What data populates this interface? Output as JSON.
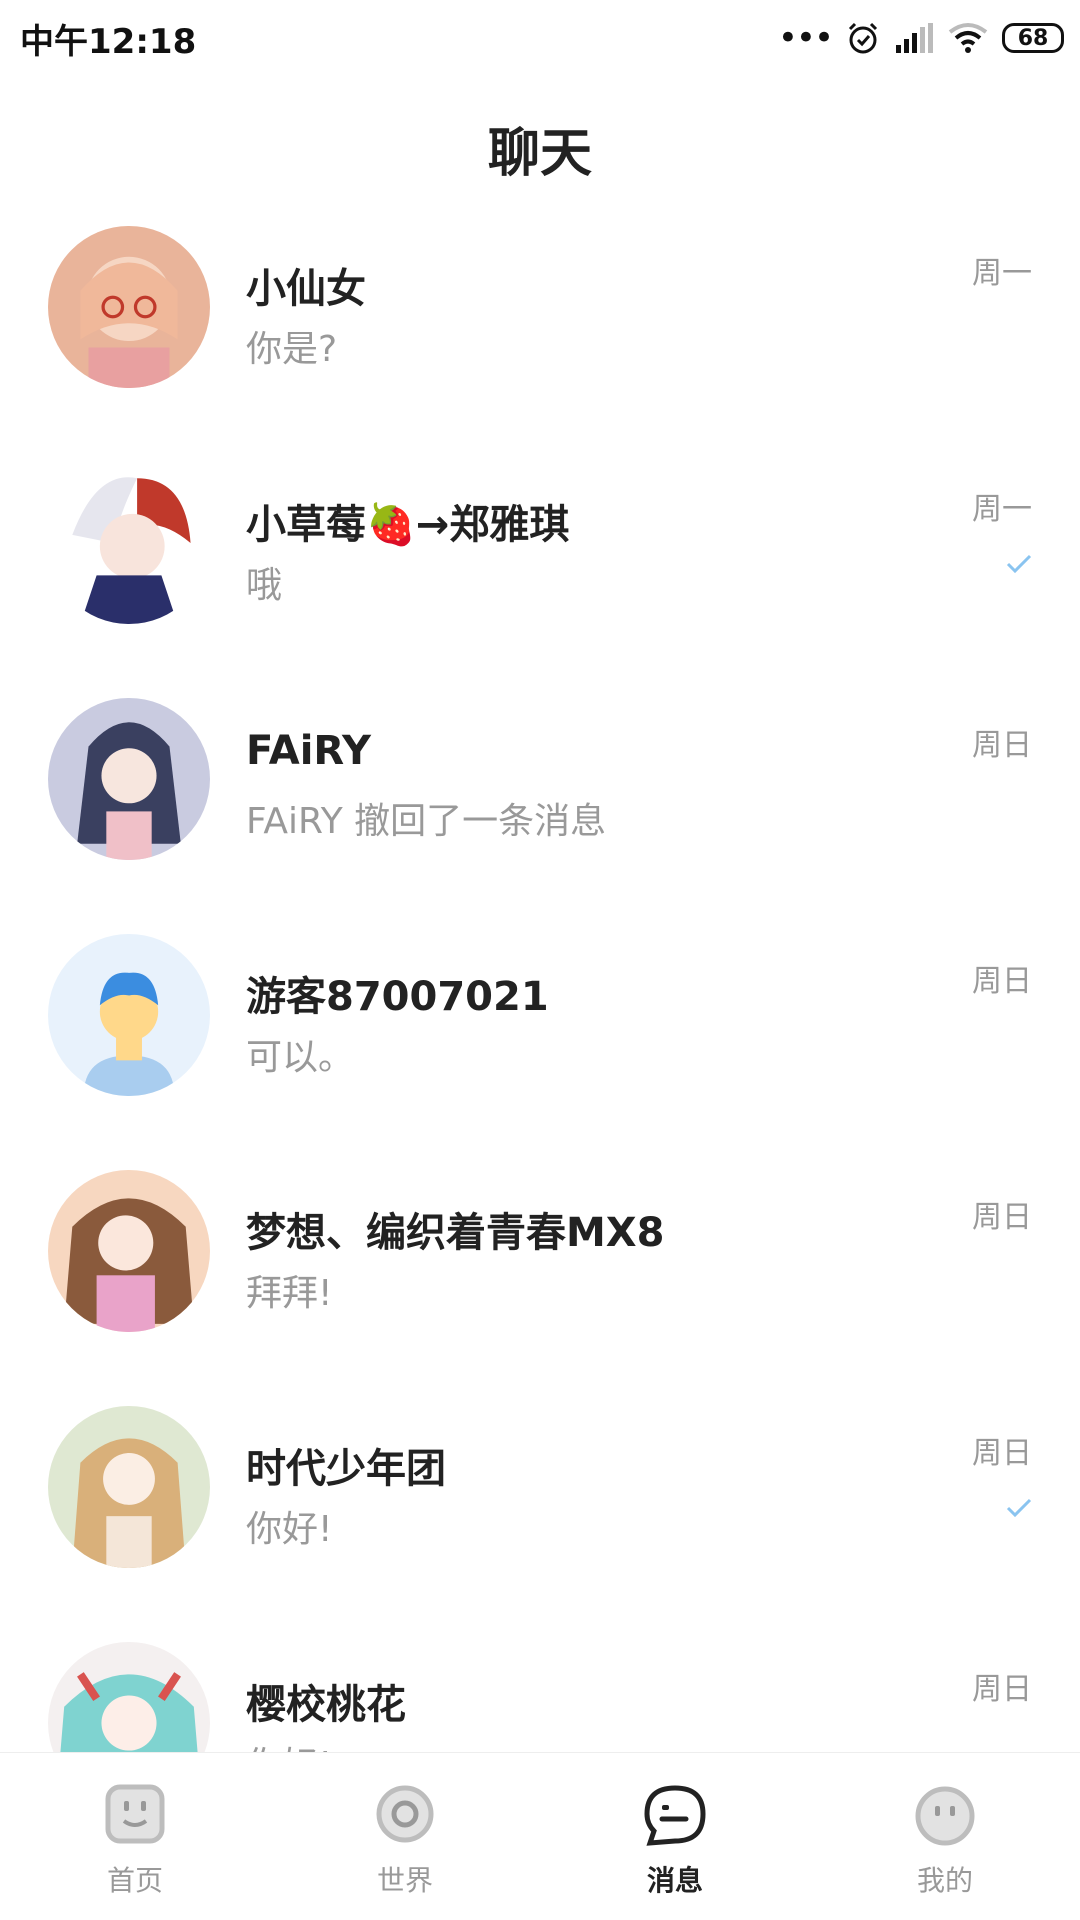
{
  "status_bar": {
    "time": "中午12:18",
    "dots": "•••",
    "battery": "68"
  },
  "header": {
    "title": "聊天"
  },
  "chats": [
    {
      "name": "小仙女",
      "preview": "你是?",
      "time": "周一",
      "read_check": false
    },
    {
      "name": "小草莓🍓→郑雅琪",
      "preview": "哦",
      "time": "周一",
      "read_check": true
    },
    {
      "name": "FAiRY",
      "preview": "FAiRY 撤回了一条消息",
      "time": "周日",
      "read_check": false
    },
    {
      "name": "游客87007021",
      "preview": "可以。",
      "time": "周日",
      "read_check": false
    },
    {
      "name": "梦想、编织着青春MX8",
      "preview": "拜拜!",
      "time": "周日",
      "read_check": false
    },
    {
      "name": "时代少年团",
      "preview": "你好!",
      "time": "周日",
      "read_check": true
    },
    {
      "name": "樱校桃花",
      "preview": "你好!",
      "time": "周日",
      "read_check": false
    }
  ],
  "bottom_nav": [
    {
      "label": "首页",
      "icon": "home-icon",
      "active": false
    },
    {
      "label": "世界",
      "icon": "world-icon",
      "active": false
    },
    {
      "label": "消息",
      "icon": "message-icon",
      "active": true
    },
    {
      "label": "我的",
      "icon": "profile-icon",
      "active": false
    }
  ],
  "colors": {
    "check": "#8ac4f0",
    "accent": "#222222",
    "muted": "#999999"
  }
}
